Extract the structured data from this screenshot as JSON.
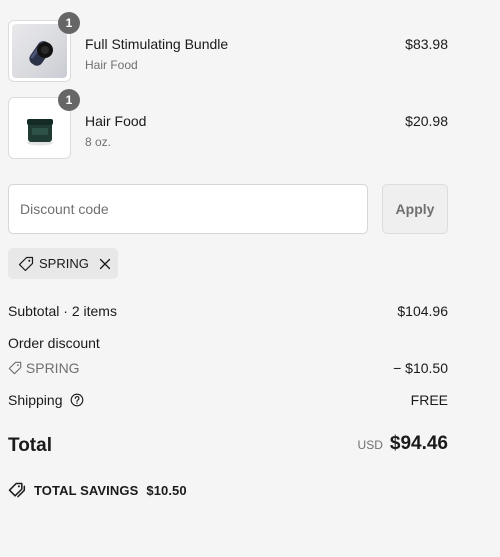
{
  "line_items": [
    {
      "name": "Full Stimulating Bundle",
      "subtitle": "Hair Food",
      "price": "$83.98",
      "quantity": "1",
      "image_icon": "bottle-product-icon"
    },
    {
      "name": "Hair Food",
      "subtitle": "8 oz.",
      "price": "$20.98",
      "quantity": "1",
      "image_icon": "jar-product-icon"
    }
  ],
  "discount": {
    "placeholder": "Discount code",
    "apply_label": "Apply",
    "applied_code": "SPRING"
  },
  "summary": {
    "subtotal_label": "Subtotal · 2 items",
    "subtotal_value": "$104.96",
    "order_discount_label": "Order discount",
    "discount_code": "SPRING",
    "discount_value": "− $10.50",
    "shipping_label": "Shipping",
    "shipping_value": "FREE"
  },
  "total": {
    "label": "Total",
    "currency": "USD",
    "amount": "$94.46"
  },
  "savings": {
    "label": "TOTAL SAVINGS",
    "amount": "$10.50"
  },
  "colors": {
    "background": "#f5f5f5",
    "text": "#1a1a1a",
    "muted": "#707070",
    "badge": "#666666",
    "chip": "#e8e8e8"
  }
}
